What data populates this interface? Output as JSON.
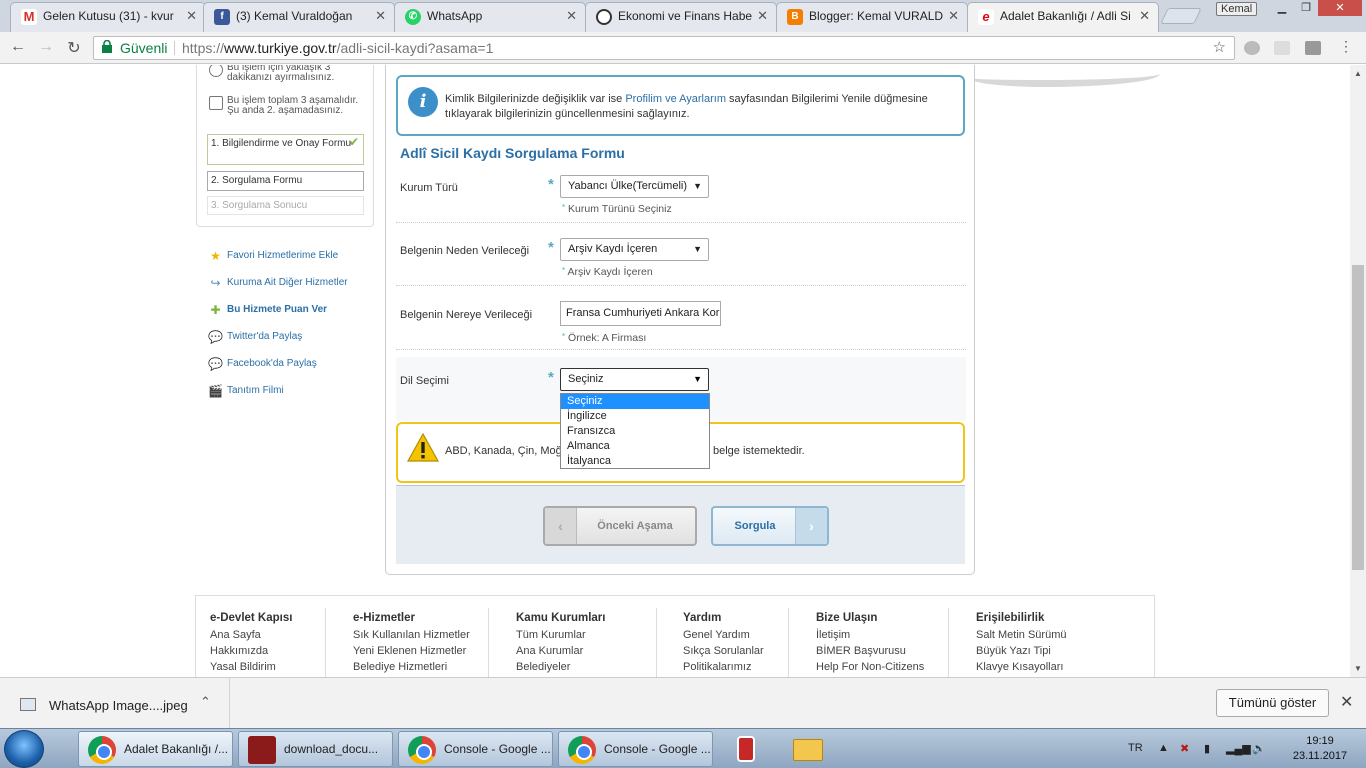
{
  "browser": {
    "tabs": [
      {
        "title": "Gelen Kutusu (31) - kvur",
        "icon": "gmail-icon",
        "color": "#d93025"
      },
      {
        "title": "(3) Kemal Vuraldoğan",
        "icon": "facebook-icon",
        "color": "#3b5998"
      },
      {
        "title": "WhatsApp",
        "icon": "whatsapp-icon",
        "color": "#25d366"
      },
      {
        "title": "Ekonomi ve Finans Habe",
        "icon": "clock-icon",
        "color": "#333333"
      },
      {
        "title": "Blogger: Kemal VURALD",
        "icon": "blogger-icon",
        "color": "#f57d00"
      },
      {
        "title": "Adalet Bakanlığı / Adli Si",
        "icon": "edevlet-icon",
        "color": "#e30a17"
      }
    ],
    "profile": "Kemal",
    "secure_label": "Güvenli",
    "url_scheme": "https://",
    "url_host": "www.turkiye.gov.tr",
    "url_path": "/adli-sicil-kaydi?asama=1"
  },
  "sidebar": {
    "info1": "Bu işlem için yaklaşık 3\ndakikanızı ayırmalısınız.",
    "info1_line1": "Bu işlem için yaklaşık 3",
    "info1_line2": "dakikanızı ayırmalısınız.",
    "info2_line1": "Bu işlem toplam 3 aşamalıdır.",
    "info2_line2": "Şu anda 2. aşamadasınız.",
    "steps": [
      {
        "label": "1. Bilgilendirme ve Onay Formu",
        "state": "done"
      },
      {
        "label": "2. Sorgulama Formu",
        "state": "current"
      },
      {
        "label": "3. Sorgulama Sonucu",
        "state": "pending"
      }
    ],
    "links": [
      {
        "label": "Favori Hizmetlerime Ekle",
        "icon": "star-icon"
      },
      {
        "label": "Kuruma Ait Diğer Hizmetler",
        "icon": "arrow-icon"
      },
      {
        "label": "Bu Hizmete Puan Ver",
        "icon": "rate-icon"
      },
      {
        "label": "Twitter'da Paylaş",
        "icon": "twitter-icon"
      },
      {
        "label": "Facebook'da Paylaş",
        "icon": "facebook-share-icon"
      },
      {
        "label": "Tanıtım Filmi",
        "icon": "film-icon"
      }
    ]
  },
  "info": {
    "text_before": "Kimlik Bilgilerinizde değişiklik var ise ",
    "link": "Profilim ve Ayarlarım",
    "text_after": " sayfasından Bilgilerimi Yenile düğmesine tıklayarak bilgilerinizin güncellenmesini sağlayınız."
  },
  "form": {
    "title": "Adlî Sicil Kaydı Sorgulama Formu",
    "kurum_label": "Kurum Türü",
    "kurum_value": "Yabancı Ülke(Tercümeli)",
    "kurum_hint": "Kurum Türünü Seçiniz",
    "neden_label": "Belgenin Neden Verileceği",
    "neden_value": "Arşiv Kaydı İçeren",
    "neden_hint": "Arşiv Kaydı İçeren",
    "nereye_label": "Belgenin Nereye Verileceği",
    "nereye_value": "Fransa Cumhuriyeti Ankara Kor",
    "nereye_hint": "Örnek: A Firması",
    "dil_label": "Dil Seçimi",
    "dil_value": "Seçiniz",
    "dil_options": [
      "Seçiniz",
      "İngilizce",
      "Fransızca",
      "Almanca",
      "İtalyanca"
    ],
    "warning_left": "ABD, Kanada, Çin, Moğo",
    "warning_right": "belge istemektedir.",
    "prev_button": "Önceki Aşama",
    "next_button": "Sorgula"
  },
  "footer": {
    "columns": [
      {
        "title": "e-Devlet Kapısı",
        "links": [
          "Ana Sayfa",
          "Hakkımızda",
          "Yasal Bildirim"
        ]
      },
      {
        "title": "e-Hizmetler",
        "links": [
          "Sık Kullanılan Hizmetler",
          "Yeni Eklenen Hizmetler",
          "Belediye Hizmetleri"
        ]
      },
      {
        "title": "Kamu Kurumları",
        "links": [
          "Tüm Kurumlar",
          "Ana Kurumlar",
          "Belediyeler"
        ]
      },
      {
        "title": "Yardım",
        "links": [
          "Genel Yardım",
          "Sıkça Sorulanlar",
          "Politikalarımız"
        ]
      },
      {
        "title": "Bize Ulaşın",
        "links": [
          "İletişim",
          "BİMER Başvurusu",
          "Help For Non-Citizens"
        ]
      },
      {
        "title": "Erişilebilirlik",
        "links": [
          "Salt Metin Sürümü",
          "Büyük Yazı Tipi",
          "Klavye Kısayolları"
        ]
      }
    ]
  },
  "download": {
    "filename": "WhatsApp Image....jpeg",
    "show_all": "Tümünü göster"
  },
  "taskbar": {
    "items": [
      {
        "label": "Adalet Bakanlığı /...",
        "icon": "chrome-icon"
      },
      {
        "label": "download_docu...",
        "icon": "pdf-icon"
      },
      {
        "label": "Console - Google ...",
        "icon": "chrome-icon"
      },
      {
        "label": "Console - Google ...",
        "icon": "chrome-icon"
      }
    ],
    "language": "TR",
    "time": "19:19",
    "date": "23.11.2017"
  }
}
